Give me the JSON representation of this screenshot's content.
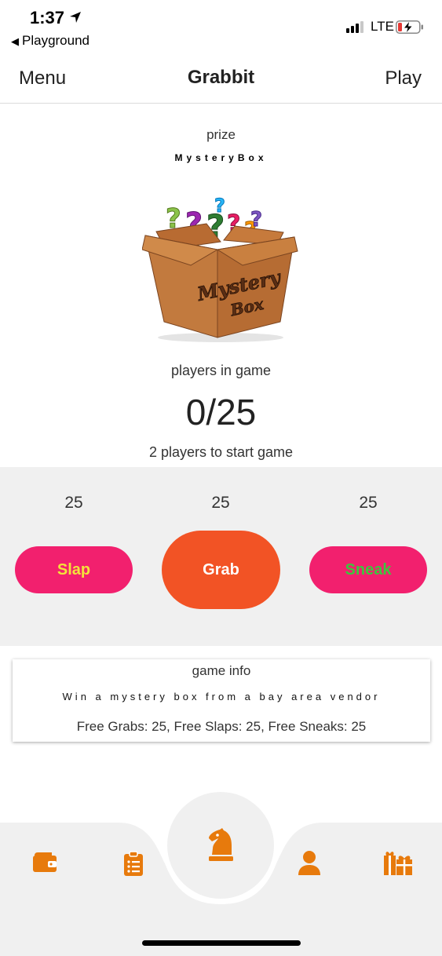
{
  "status_bar": {
    "time": "1:37",
    "back_app": "Playground",
    "network": "LTE"
  },
  "nav": {
    "left": "Menu",
    "title": "Grabbit",
    "right": "Play"
  },
  "prize": {
    "label": "prize",
    "name": "MysteryBox",
    "image_text_line1": "Mystery",
    "image_text_line2": "Box"
  },
  "players": {
    "label": "players in game",
    "count": "0/25",
    "start_note": "2 players to start game"
  },
  "actions": {
    "slap": {
      "count": "25",
      "label": "Slap"
    },
    "grab": {
      "count": "25",
      "label": "Grab"
    },
    "sneak": {
      "count": "25",
      "label": "Sneak"
    }
  },
  "game_info": {
    "title": "game info",
    "description": "Win a mystery box from a bay area vendor",
    "free_items": "Free Grabs: 25, Free Slaps: 25, Free Sneaks: 25"
  },
  "tabs": [
    {
      "icon": "wallet-icon"
    },
    {
      "icon": "clipboard-icon"
    },
    {
      "icon": "chess-knight-icon",
      "active": true
    },
    {
      "icon": "person-icon"
    },
    {
      "icon": "gifts-icon"
    }
  ],
  "colors": {
    "accent": "#e77a0c",
    "slap_bg": "#f2206e",
    "grab_bg": "#f25325",
    "slap_text": "#f3e13a",
    "sneak_text": "#3ec43e",
    "panel_bg": "#f0f0f0"
  }
}
